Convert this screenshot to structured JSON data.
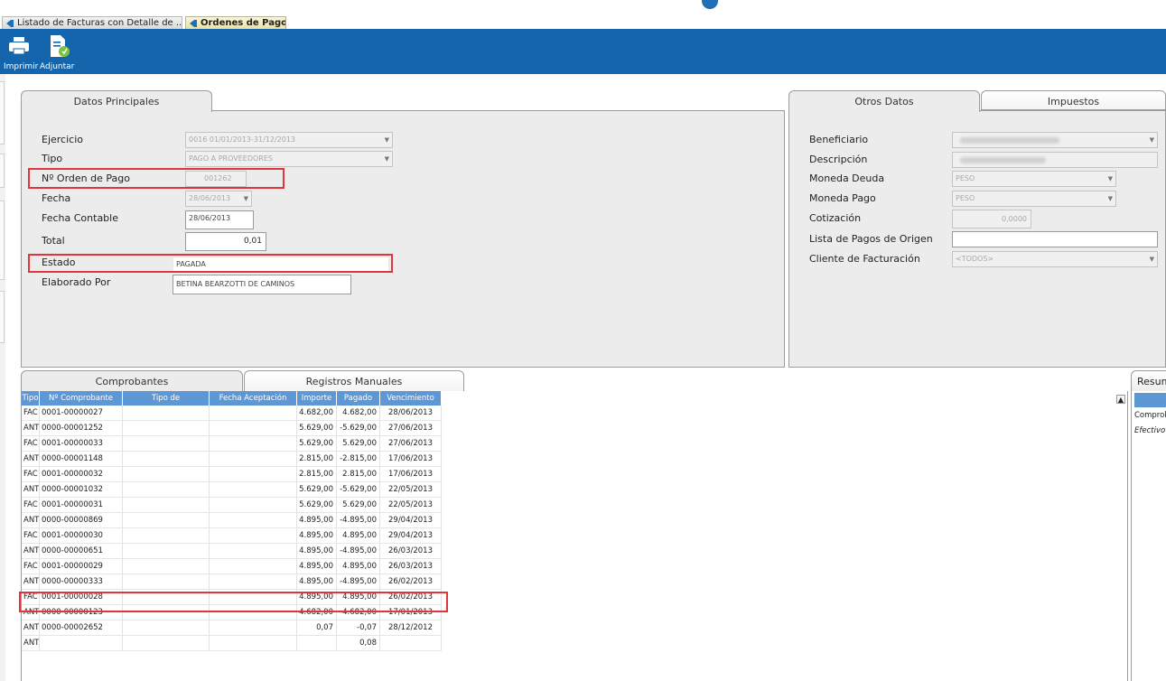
{
  "doc_tabs": [
    {
      "label": "Listado de Facturas con Detalle de ..."
    },
    {
      "label": "Ordenes de Pago"
    }
  ],
  "toolbar": {
    "print_label": "Imprimir",
    "attach_label": "Adjuntar"
  },
  "main_panel": {
    "tab_label": "Datos Principales",
    "fields": {
      "ejercicio": {
        "label": "Ejercicio",
        "value": "0016 01/01/2013-31/12/2013"
      },
      "tipo": {
        "label": "Tipo",
        "value": "PAGO A PROVEEDORES"
      },
      "orden": {
        "label": "Nº Orden de Pago",
        "value": "001262"
      },
      "fecha": {
        "label": "Fecha",
        "value": "28/06/2013"
      },
      "fecha_contable": {
        "label": "Fecha Contable",
        "value": "28/06/2013"
      },
      "total": {
        "label": "Total",
        "value": "0,01"
      },
      "estado": {
        "label": "Estado",
        "value": "PAGADA"
      },
      "elaborado": {
        "label": "Elaborado Por",
        "value": "BETINA BEARZOTTI DE CAMINOS"
      }
    }
  },
  "side_panel": {
    "tabs": [
      "Otros Datos",
      "Impuestos"
    ],
    "fields": {
      "beneficiario": {
        "label": "Beneficiario"
      },
      "descripcion": {
        "label": "Descripción"
      },
      "moneda_deuda": {
        "label": "Moneda Deuda",
        "value": "PESO"
      },
      "moneda_pago": {
        "label": "Moneda Pago",
        "value": "PESO"
      },
      "cotizacion": {
        "label": "Cotización",
        "value": "0,0000"
      },
      "lista_pagos": {
        "label": "Lista de Pagos de Origen",
        "value": ""
      },
      "cliente": {
        "label": "Cliente de Facturación",
        "value": "<TODOS>"
      }
    }
  },
  "grid_tabs": [
    "Comprobantes",
    "Registros Manuales"
  ],
  "grid": {
    "columns": [
      "Tipo",
      "Nº Comprobante",
      "Tipo de",
      "Fecha Aceptación",
      "Importe",
      "Pagado",
      "Vencimiento"
    ],
    "rows": [
      [
        "FAC",
        "0001-00000027",
        "",
        "",
        "4.682,00",
        "4.682,00",
        "28/06/2013"
      ],
      [
        "ANT",
        "0000-00001252",
        "",
        "",
        "5.629,00",
        "-5.629,00",
        "27/06/2013"
      ],
      [
        "FAC",
        "0001-00000033",
        "",
        "",
        "5.629,00",
        "5.629,00",
        "27/06/2013"
      ],
      [
        "ANT",
        "0000-00001148",
        "",
        "",
        "2.815,00",
        "-2.815,00",
        "17/06/2013"
      ],
      [
        "FAC",
        "0001-00000032",
        "",
        "",
        "2.815,00",
        "2.815,00",
        "17/06/2013"
      ],
      [
        "ANT",
        "0000-00001032",
        "",
        "",
        "5.629,00",
        "-5.629,00",
        "22/05/2013"
      ],
      [
        "FAC",
        "0001-00000031",
        "",
        "",
        "5.629,00",
        "5.629,00",
        "22/05/2013"
      ],
      [
        "ANT",
        "0000-00000869",
        "",
        "",
        "4.895,00",
        "-4.895,00",
        "29/04/2013"
      ],
      [
        "FAC",
        "0001-00000030",
        "",
        "",
        "4.895,00",
        "4.895,00",
        "29/04/2013"
      ],
      [
        "ANT",
        "0000-00000651",
        "",
        "",
        "4.895,00",
        "-4.895,00",
        "26/03/2013"
      ],
      [
        "FAC",
        "0001-00000029",
        "",
        "",
        "4.895,00",
        "4.895,00",
        "26/03/2013"
      ],
      [
        "ANT",
        "0000-00000333",
        "",
        "",
        "4.895,00",
        "-4.895,00",
        "26/02/2013"
      ],
      [
        "FAC",
        "0001-00000028",
        "",
        "",
        "4.895,00",
        "4.895,00",
        "26/02/2013"
      ],
      [
        "ANT",
        "0000-00000123",
        "",
        "",
        "4.682,00",
        "-4.682,00",
        "17/01/2013"
      ],
      [
        "ANT",
        "0000-00002652",
        "",
        "",
        "0,07",
        "-0,07",
        "28/12/2012"
      ],
      [
        "ANT",
        "",
        "",
        "",
        "",
        "0,08",
        ""
      ]
    ]
  },
  "resumen": {
    "tab_label": "Resumen",
    "items": [
      "Comprobantes",
      "Efectivo"
    ]
  },
  "colors": {
    "toolbar": "#1565ad",
    "grid_header": "#5e97d6",
    "highlight": "#e0353c"
  }
}
